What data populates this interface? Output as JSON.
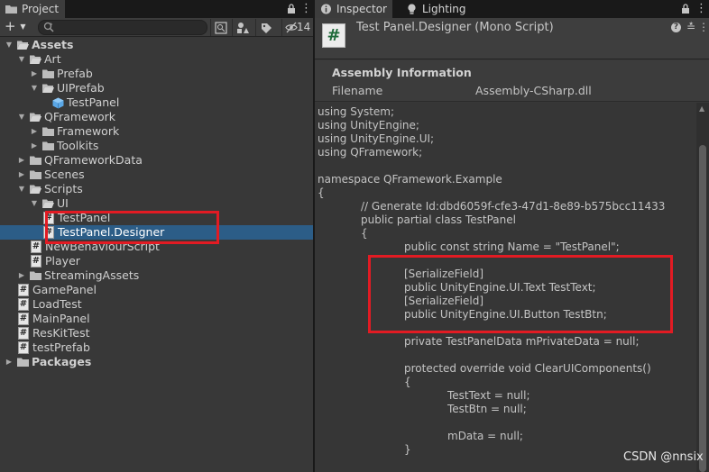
{
  "project": {
    "tab_label": "Project",
    "add_label": "+",
    "search": {
      "value": "",
      "placeholder": ""
    },
    "hidden_count": "14",
    "tree": [
      {
        "label": "Assets",
        "depth": 0,
        "expanded": true,
        "kind": "folder-open",
        "bold": true
      },
      {
        "label": "Art",
        "depth": 1,
        "expanded": true,
        "kind": "folder-open"
      },
      {
        "label": "Prefab",
        "depth": 2,
        "expanded": false,
        "kind": "folder"
      },
      {
        "label": "UIPrefab",
        "depth": 2,
        "expanded": true,
        "kind": "folder-open"
      },
      {
        "label": "TestPanel",
        "depth": 3,
        "kind": "prefab"
      },
      {
        "label": "QFramework",
        "depth": 1,
        "expanded": true,
        "kind": "folder-open"
      },
      {
        "label": "Framework",
        "depth": 2,
        "expanded": false,
        "kind": "folder"
      },
      {
        "label": "Toolkits",
        "depth": 2,
        "expanded": false,
        "kind": "folder"
      },
      {
        "label": "QFrameworkData",
        "depth": 1,
        "expanded": false,
        "kind": "folder"
      },
      {
        "label": "Scenes",
        "depth": 1,
        "expanded": false,
        "kind": "folder"
      },
      {
        "label": "Scripts",
        "depth": 1,
        "expanded": true,
        "kind": "folder-open"
      },
      {
        "label": "UI",
        "depth": 2,
        "expanded": true,
        "kind": "folder-open"
      },
      {
        "label": "TestPanel",
        "depth": 3,
        "kind": "script"
      },
      {
        "label": "TestPanel.Designer",
        "depth": 3,
        "kind": "script",
        "selected": true
      },
      {
        "label": "NewBehaviourScript",
        "depth": 2,
        "kind": "script"
      },
      {
        "label": "Player",
        "depth": 2,
        "kind": "script"
      },
      {
        "label": "StreamingAssets",
        "depth": 1,
        "expanded": false,
        "kind": "folder"
      },
      {
        "label": "GamePanel",
        "depth": 1,
        "kind": "script"
      },
      {
        "label": "LoadTest",
        "depth": 1,
        "kind": "script"
      },
      {
        "label": "MainPanel",
        "depth": 1,
        "kind": "script"
      },
      {
        "label": "ResKitTest",
        "depth": 1,
        "kind": "script"
      },
      {
        "label": "testPrefab",
        "depth": 1,
        "kind": "script"
      },
      {
        "label": "Packages",
        "depth": 0,
        "expanded": false,
        "kind": "folder",
        "bold": true
      }
    ]
  },
  "inspector": {
    "tab_inspector": "Inspector",
    "tab_lighting": "Lighting",
    "title": "Test Panel.Designer (Mono Script)",
    "script_icon_glyph": "#",
    "assembly": {
      "title": "Assembly Information",
      "filename_label": "Filename",
      "filename_value": "Assembly-CSharp.dll"
    },
    "code_lines": [
      {
        "text": "using System;",
        "indent": 0
      },
      {
        "text": "using UnityEngine;",
        "indent": 0
      },
      {
        "text": "using UnityEngine.UI;",
        "indent": 0
      },
      {
        "text": "using QFramework;",
        "indent": 0
      },
      {
        "text": "",
        "indent": 0
      },
      {
        "text": "namespace QFramework.Example",
        "indent": 0
      },
      {
        "text": "{",
        "indent": 0
      },
      {
        "text": "// Generate Id:dbd6059f-cfe3-47d1-8e89-b575bcc11433",
        "indent": 1
      },
      {
        "text": "public partial class TestPanel",
        "indent": 1
      },
      {
        "text": "{",
        "indent": 1
      },
      {
        "text": "public const string Name = \"TestPanel\";",
        "indent": 2
      },
      {
        "text": "",
        "indent": 0
      },
      {
        "text": "[SerializeField]",
        "indent": 2
      },
      {
        "text": "public UnityEngine.UI.Text TestText;",
        "indent": 2
      },
      {
        "text": "[SerializeField]",
        "indent": 2
      },
      {
        "text": "public UnityEngine.UI.Button TestBtn;",
        "indent": 2
      },
      {
        "text": "",
        "indent": 0
      },
      {
        "text": "private TestPanelData mPrivateData = null;",
        "indent": 2
      },
      {
        "text": "",
        "indent": 0
      },
      {
        "text": "protected override void ClearUIComponents()",
        "indent": 2
      },
      {
        "text": "{",
        "indent": 2
      },
      {
        "text": "TestText = null;",
        "indent": 3
      },
      {
        "text": "TestBtn = null;",
        "indent": 3
      },
      {
        "text": "",
        "indent": 0
      },
      {
        "text": "mData = null;",
        "indent": 3
      },
      {
        "text": "}",
        "indent": 2
      }
    ]
  },
  "watermark": "CSDN @nnsix",
  "colors": {
    "selection": "#2c5d87",
    "highlight": "#e21b23",
    "panel_bg": "#383838",
    "code_bg": "#363636"
  }
}
